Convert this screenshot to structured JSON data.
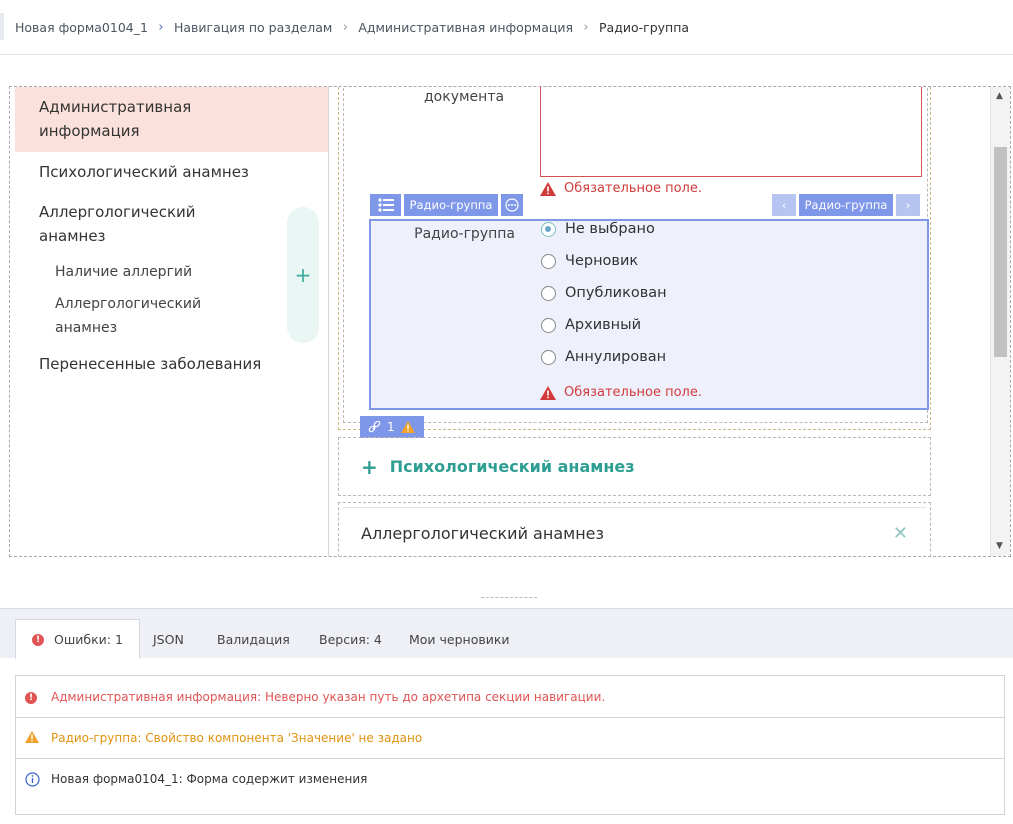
{
  "breadcrumb": {
    "items": [
      "Новая форма0104_1",
      "Навигация по разделам",
      "Административная информация",
      "Радио-группа"
    ]
  },
  "nav": {
    "items": [
      {
        "label": "Административная",
        "label2": "информация"
      },
      {
        "label": "Психологический анамнез"
      },
      {
        "label": "Аллергологический",
        "label2": "анамнез"
      },
      {
        "label": "Перенесенные заболевания"
      }
    ],
    "subitems": [
      "Наличие аллергий",
      "Аллергологический",
      "анамнез"
    ],
    "add_symbol": "+"
  },
  "form": {
    "doc_label": "документа",
    "required_error": "Обязательное поле.",
    "radio_label": "Радио-группа",
    "toolbar_name": "Радио-группа",
    "toolbar_name_right": "Радио-группа",
    "radio_options": [
      "Не выбрано",
      "Черновик",
      "Опубликован",
      "Архивный",
      "Аннулирован"
    ],
    "selected_index": 0,
    "link_count": "1",
    "section_add": "Психологический анамнез",
    "section_add_symbol": "+",
    "section_allergy": "Аллергологический анамнез"
  },
  "bottom": {
    "tabs": [
      "Ошибки: 1",
      "JSON",
      "Валидация",
      "Версия: 4",
      "Мои черновики"
    ],
    "messages": [
      {
        "type": "error",
        "text": "Административная информация: Неверно указан путь до архетипа секции навигации."
      },
      {
        "type": "warn",
        "text": "Радио-группа: Свойство компонента 'Значение' не задано"
      },
      {
        "type": "info",
        "text": "Новая форма0104_1: Форма содержит изменения"
      }
    ]
  },
  "colors": {
    "accent": "#7f97e8",
    "error": "#e05454",
    "warning": "#e0930f",
    "teal": "#2e9e93",
    "active_nav": "#fbe1db"
  }
}
